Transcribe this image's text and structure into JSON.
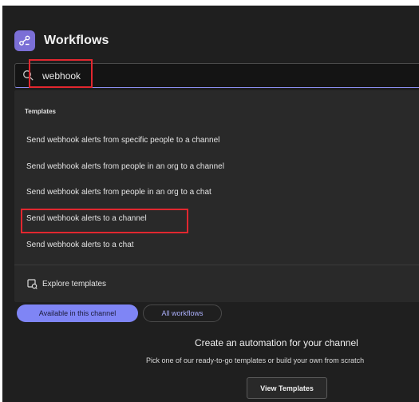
{
  "app": {
    "title": "Workflows",
    "accent_color": "#7b6fd6",
    "icon": "workflows-icon"
  },
  "search": {
    "value": "webhook",
    "icon": "search-icon",
    "clear_icon": "close-icon",
    "clear_glyph": "✕"
  },
  "dropdown": {
    "section_heading": "Templates",
    "items": [
      "Send webhook alerts from specific people to a channel",
      "Send webhook alerts from people in an org to a channel",
      "Send webhook alerts from people in an org to a chat",
      "Send webhook alerts to a channel",
      "Send webhook alerts to a chat"
    ],
    "explore_label": "Explore templates",
    "explore_icon": "explore-templates-icon"
  },
  "filters": {
    "active_label": "Available in this channel",
    "inactive_label": "All workflows"
  },
  "empty_state": {
    "title": "Create an automation for your channel",
    "subtitle": "Pick one of our ready-to-go templates or build your own from scratch",
    "button_label": "View Templates"
  },
  "highlight_color": "#e2272f"
}
